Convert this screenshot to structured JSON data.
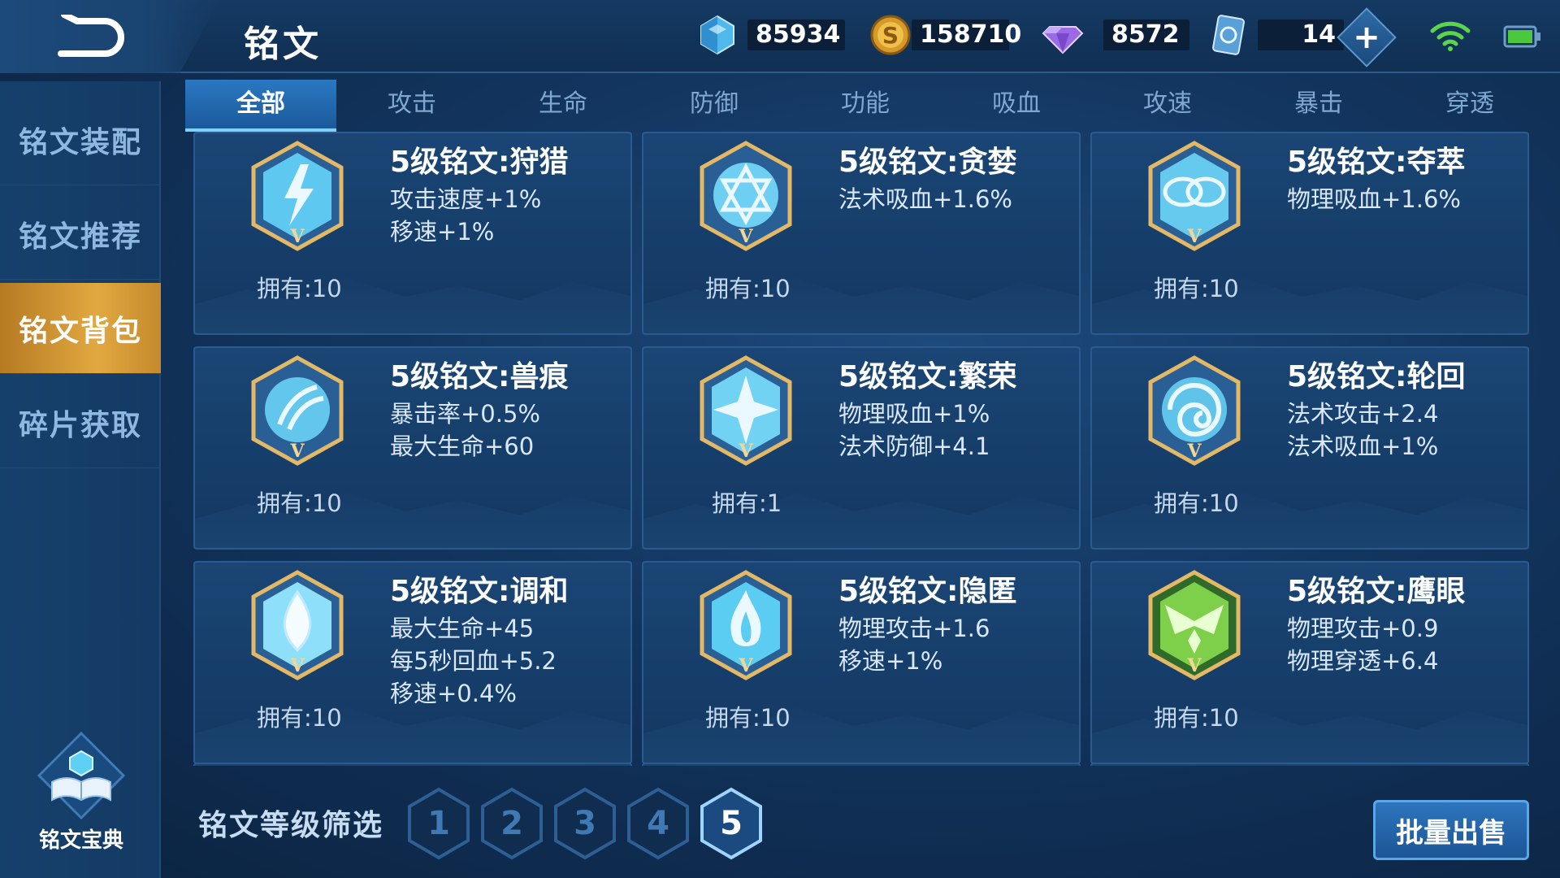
{
  "header": {
    "title": "铭文",
    "back_icon": "back-arrow-icon"
  },
  "currencies": {
    "crystal": {
      "icon": "blue-crystal-icon",
      "value": "85934"
    },
    "gold": {
      "icon": "gold-coin-icon",
      "value": "158710"
    },
    "gem": {
      "icon": "purple-diamond-icon",
      "value": "8572"
    },
    "card": {
      "icon": "rune-card-icon",
      "value": "14"
    },
    "plus_icon": "plus-icon"
  },
  "status": {
    "wifi_icon": "wifi-icon",
    "battery_icon": "battery-icon"
  },
  "tabs": [
    {
      "label": "全部",
      "active": true
    },
    {
      "label": "攻击",
      "active": false
    },
    {
      "label": "生命",
      "active": false
    },
    {
      "label": "防御",
      "active": false
    },
    {
      "label": "功能",
      "active": false
    },
    {
      "label": "吸血",
      "active": false
    },
    {
      "label": "攻速",
      "active": false
    },
    {
      "label": "暴击",
      "active": false
    },
    {
      "label": "穿透",
      "active": false
    }
  ],
  "sidebar": {
    "items": [
      {
        "label": "铭文装配",
        "active": false
      },
      {
        "label": "铭文推荐",
        "active": false
      },
      {
        "label": "铭文背包",
        "active": true
      },
      {
        "label": "碎片获取",
        "active": false
      }
    ],
    "codex_label": "铭文宝典",
    "codex_icon": "book-icon"
  },
  "runes": [
    {
      "name": "5级铭文:狩猎",
      "stats": [
        "攻击速度+1%",
        "移速+1%"
      ],
      "owned": "拥有:10",
      "icon": "lightning-rune-icon",
      "color": "#5ec8f0"
    },
    {
      "name": "5级铭文:贪婪",
      "stats": [
        "法术吸血+1.6%"
      ],
      "owned": "拥有:10",
      "icon": "star-rune-icon",
      "color": "#6fcff2"
    },
    {
      "name": "5级铭文:夺萃",
      "stats": [
        "物理吸血+1.6%"
      ],
      "owned": "拥有:10",
      "icon": "knot-rune-icon",
      "color": "#66c9ee"
    },
    {
      "name": "5级铭文:兽痕",
      "stats": [
        "暴击率+0.5%",
        "最大生命+60"
      ],
      "owned": "拥有:10",
      "icon": "claw-rune-icon",
      "color": "#63c6ec"
    },
    {
      "name": "5级铭文:繁荣",
      "stats": [
        "物理吸血+1%",
        "法术防御+4.1"
      ],
      "owned": "拥有:1",
      "icon": "crystal-rune-icon",
      "color": "#72d2f4"
    },
    {
      "name": "5级铭文:轮回",
      "stats": [
        "法术攻击+2.4",
        "法术吸血+1%"
      ],
      "owned": "拥有:10",
      "icon": "swirl-rune-icon",
      "color": "#60c4ea"
    },
    {
      "name": "5级铭文:调和",
      "stats": [
        "最大生命+45",
        "每5秒回血+5.2",
        "移速+0.4%"
      ],
      "owned": "拥有:10",
      "icon": "drop-rune-icon",
      "color": "#8ee0fa"
    },
    {
      "name": "5级铭文:隐匿",
      "stats": [
        "物理攻击+1.6",
        "移速+1%"
      ],
      "owned": "拥有:10",
      "icon": "flame-rune-icon",
      "color": "#5ccdf2"
    },
    {
      "name": "5级铭文:鹰眼",
      "stats": [
        "物理攻击+0.9",
        "物理穿透+6.4"
      ],
      "owned": "拥有:10",
      "icon": "eagle-rune-icon",
      "color": "#7ed04a"
    }
  ],
  "rune_level_mark": "V",
  "filter": {
    "label": "铭文等级筛选",
    "levels": [
      "1",
      "2",
      "3",
      "4",
      "5"
    ],
    "selected": "5"
  },
  "sell_button": "批量出售"
}
